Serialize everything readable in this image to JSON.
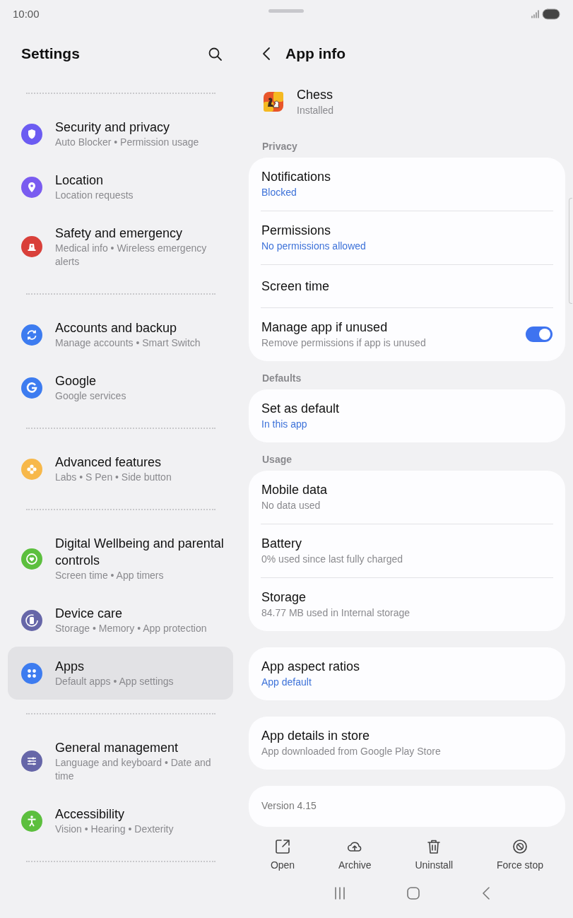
{
  "status_bar": {
    "time": "10:00"
  },
  "settings": {
    "title": "Settings",
    "groups": [
      {
        "items": [
          {
            "title": "Security and privacy",
            "subtitle": "Auto Blocker • Permission usage",
            "color": "#6c5cf2",
            "selected": false
          },
          {
            "title": "Location",
            "subtitle": "Location requests",
            "color": "#7a5cf0",
            "selected": false
          },
          {
            "title": "Safety and emergency",
            "subtitle": "Medical info • Wireless emergency alerts",
            "color": "#d9403a",
            "selected": false
          }
        ]
      },
      {
        "items": [
          {
            "title": "Accounts and backup",
            "subtitle": "Manage accounts • Smart Switch",
            "color": "#3d7cf0",
            "selected": false
          },
          {
            "title": "Google",
            "subtitle": "Google services",
            "color": "#3d7cf0",
            "selected": false
          }
        ]
      },
      {
        "items": [
          {
            "title": "Advanced features",
            "subtitle": "Labs • S Pen • Side button",
            "color": "#f7b84a",
            "selected": false
          }
        ]
      },
      {
        "items": [
          {
            "title": "Digital Wellbeing and parental controls",
            "subtitle": "Screen time • App timers",
            "color": "#5cbf3e",
            "selected": false
          },
          {
            "title": "Device care",
            "subtitle": "Storage • Memory • App protection",
            "color": "#6666a8",
            "selected": false
          },
          {
            "title": "Apps",
            "subtitle": "Default apps • App settings",
            "color": "#3d7cf0",
            "selected": true
          }
        ]
      },
      {
        "items": [
          {
            "title": "General management",
            "subtitle": "Language and keyboard • Date and time",
            "color": "#6666a8",
            "selected": false
          },
          {
            "title": "Accessibility",
            "subtitle": "Vision • Hearing • Dexterity",
            "color": "#5cbf3e",
            "selected": false
          }
        ]
      }
    ]
  },
  "app_info": {
    "title": "App info",
    "app": {
      "name": "Chess",
      "status": "Installed"
    },
    "sections": [
      {
        "label": "Privacy",
        "cards": [
          {
            "rows": [
              {
                "kind": "text",
                "title": "Notifications",
                "subtitle": "Blocked",
                "accent": true
              },
              {
                "kind": "text",
                "title": "Permissions",
                "subtitle": "No permissions allowed",
                "accent": true
              },
              {
                "kind": "text",
                "title": "Screen time"
              },
              {
                "kind": "toggle",
                "title": "Manage app if unused",
                "subtitle": "Remove permissions if app is unused",
                "accent": false,
                "on": true
              }
            ]
          }
        ]
      },
      {
        "label": "Defaults",
        "cards": [
          {
            "rows": [
              {
                "kind": "text",
                "title": "Set as default",
                "subtitle": "In this app",
                "accent": true
              }
            ]
          }
        ]
      },
      {
        "label": "Usage",
        "cards": [
          {
            "rows": [
              {
                "kind": "text",
                "title": "Mobile data",
                "subtitle": "No data used",
                "accent": false
              },
              {
                "kind": "text",
                "title": "Battery",
                "subtitle": "0% used since last fully charged",
                "accent": false
              },
              {
                "kind": "text",
                "title": "Storage",
                "subtitle": "84.77 MB used in Internal storage",
                "accent": false
              }
            ]
          },
          {
            "rows": [
              {
                "kind": "text",
                "title": "App aspect ratios",
                "subtitle": "App default",
                "accent": true
              }
            ]
          },
          {
            "rows": [
              {
                "kind": "text",
                "title": "App details in store",
                "subtitle": "App downloaded from Google Play Store",
                "accent": false
              }
            ]
          },
          {
            "rows": [
              {
                "kind": "info",
                "title": "Version 4.15"
              }
            ]
          }
        ]
      }
    ],
    "actions": [
      {
        "label": "Open"
      },
      {
        "label": "Archive"
      },
      {
        "label": "Uninstall"
      },
      {
        "label": "Force stop"
      }
    ]
  }
}
